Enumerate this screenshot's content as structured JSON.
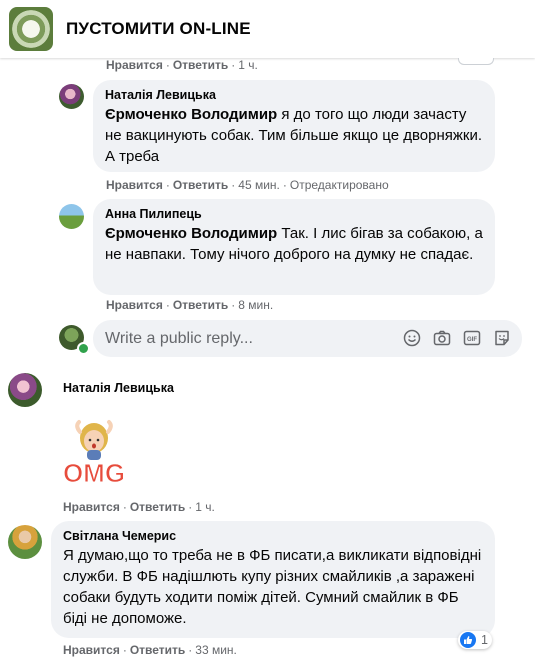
{
  "header": {
    "title": "ПУСТОМИТИ ON-LINE"
  },
  "labels": {
    "like": "Нравится",
    "reply": "Ответить",
    "dot": "·"
  },
  "comments": [
    {
      "time": "1 ч."
    },
    {
      "author": "Наталія Левицька",
      "mention": "Єрмоченко Володимир",
      "text": " я до того що люди зачасту не вакцинують собак. Тим більше якщо це дворняжки. А треба",
      "time": "45 мин.",
      "edited": "Отредактировано"
    },
    {
      "author": "Анна Пилипець",
      "mention": "Єрмоченко Володимир",
      "text": " Так. І лис бігав за собакою, а не навпаки. Тому нічого доброго на думку не спадає.",
      "time": "8 мин."
    },
    {
      "author": "Наталія Левицька",
      "sticker": "OMG",
      "time": "1 ч."
    },
    {
      "author": "Світлана Чемерис",
      "text": "Я думаю,що то треба не в ФБ писати,а викликати відповідні служби. В ФБ надішлють купу різних смайликів ,а заражені собаки будуть ходити поміж дітей. Сумний смайлик в ФБ біді не допоможе.",
      "time": "33 мин.",
      "reactions": "1"
    }
  ],
  "reply_box": {
    "placeholder": "Write a public reply...",
    "icons": [
      "emoji-icon",
      "camera-icon",
      "gif-icon",
      "sticker-icon"
    ],
    "gif_label": "GIF"
  },
  "colors": {
    "accent": "#1877f2",
    "bubble": "#f0f2f5",
    "meta": "#65676b"
  }
}
